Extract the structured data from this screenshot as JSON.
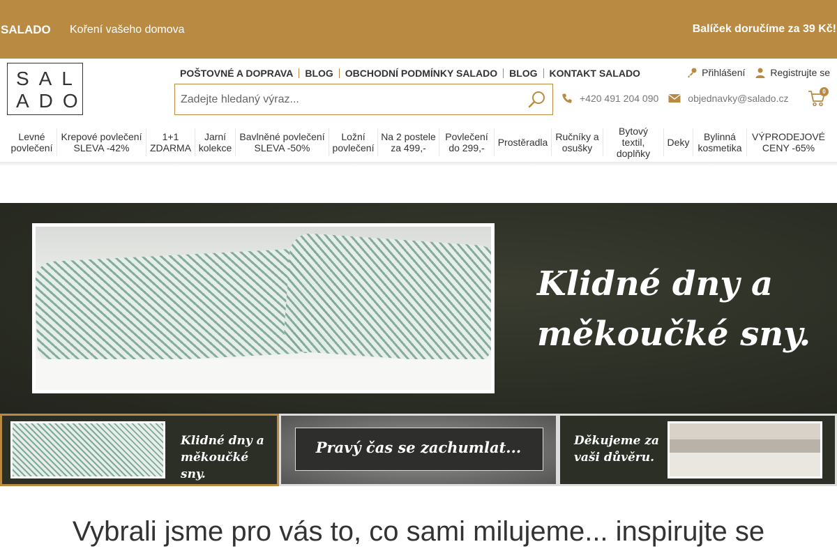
{
  "topbar": {
    "brand": "SALADO",
    "tagline": "Koření vašeho domova",
    "shipping": "Balíček doručíme za 39 Kč!"
  },
  "logo": {
    "line1": "SAL",
    "line2": "ADO"
  },
  "toplinks": [
    "POŠTOVNÉ A DOPRAVA",
    "BLOG",
    "OBCHODNÍ PODMÍNKY SALADO",
    "BLOG",
    "KONTAKT SALADO"
  ],
  "account": {
    "login": "Přihlášení",
    "register": "Registrujte se"
  },
  "search": {
    "placeholder": "Zadejte hledaný výraz..."
  },
  "contact": {
    "phone": "+420 491 204 090",
    "email": "objednavky@salado.cz"
  },
  "cart": {
    "count": "0"
  },
  "categories": [
    "Levné povlečení",
    "Krepové povlečení SLEVA -42%",
    "1+1 ZDARMA",
    "Jarní kolekce",
    "Bavlněné povlečení SLEVA -50%",
    "Ložní povlečení",
    "Na 2 postele za 499,-",
    "Povlečení do 299,-",
    "Prostěradla",
    "Ručníky a osušky",
    "Bytový textil, doplňky",
    "Deky",
    "Bylinná kosmetika",
    "VÝPRODEJOVÉ CENY -65%"
  ],
  "hero": {
    "title_line1": "Klidné dny a",
    "title_line2": "měkoučké sny."
  },
  "thumbs": [
    {
      "line1": "Klidné dny a",
      "line2": "měkoučké sny."
    },
    {
      "line1": "Pravý čas se zachumlat..."
    },
    {
      "line1": "Děkujeme za",
      "line2": "vaši důvěru."
    }
  ],
  "section_heading": "Vybrali jsme pro vás to, co sami milujeme... inspirujte se",
  "colors": {
    "accent": "#b98a42",
    "hero_bg": "#2c2f25"
  },
  "icons": [
    "key-icon",
    "user-icon",
    "search-icon",
    "phone-icon",
    "mail-icon",
    "cart-icon"
  ]
}
